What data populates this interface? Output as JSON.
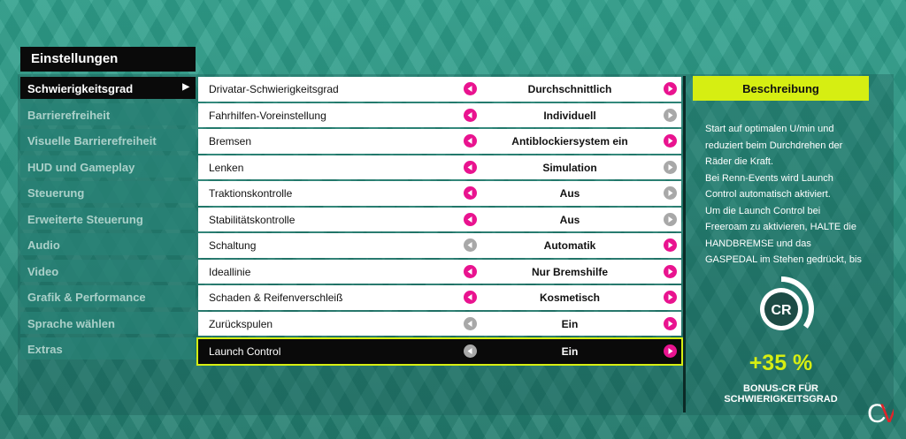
{
  "page": {
    "title": "Einstellungen"
  },
  "sidebar": {
    "items": [
      {
        "label": "Schwierigkeitsgrad",
        "active": true
      },
      {
        "label": "Barrierefreiheit"
      },
      {
        "label": "Visuelle Barrierefreiheit"
      },
      {
        "label": "HUD und Gameplay"
      },
      {
        "label": "Steuerung"
      },
      {
        "label": "Erweiterte Steuerung"
      },
      {
        "label": "Audio"
      },
      {
        "label": "Video"
      },
      {
        "label": "Grafik & Performance"
      },
      {
        "label": "Sprache wählen"
      },
      {
        "label": "Extras"
      }
    ]
  },
  "settings": [
    {
      "label": "Drivatar-Schwierigkeitsgrad",
      "value": "Durchschnittlich",
      "prev_enabled": true,
      "next_enabled": true
    },
    {
      "label": "Fahrhilfen-Voreinstellung",
      "value": "Individuell",
      "prev_enabled": true,
      "next_enabled": false
    },
    {
      "label": "Bremsen",
      "value": "Antiblockiersystem ein",
      "prev_enabled": true,
      "next_enabled": true
    },
    {
      "label": "Lenken",
      "value": "Simulation",
      "prev_enabled": true,
      "next_enabled": false
    },
    {
      "label": "Traktionskontrolle",
      "value": "Aus",
      "prev_enabled": true,
      "next_enabled": false
    },
    {
      "label": "Stabilitätskontrolle",
      "value": "Aus",
      "prev_enabled": true,
      "next_enabled": false
    },
    {
      "label": "Schaltung",
      "value": "Automatik",
      "prev_enabled": false,
      "next_enabled": true
    },
    {
      "label": "Ideallinie",
      "value": "Nur Bremshilfe",
      "prev_enabled": true,
      "next_enabled": true
    },
    {
      "label": "Schaden & Reifenverschleiß",
      "value": "Kosmetisch",
      "prev_enabled": true,
      "next_enabled": true
    },
    {
      "label": "Zurückspulen",
      "value": "Ein",
      "prev_enabled": false,
      "next_enabled": true
    },
    {
      "label": "Launch Control",
      "value": "Ein",
      "prev_enabled": false,
      "next_enabled": true,
      "focused": true
    }
  ],
  "description": {
    "heading": "Beschreibung",
    "lines": [
      "Start auf optimalen U/min und",
      "reduziert beim Durchdrehen der",
      "Räder die Kraft.",
      "Bei Renn-Events wird Launch",
      "Control automatisch aktiviert.",
      "Um die Launch Control bei",
      "Freeroam zu aktivieren, HALTE die",
      "HANDBREMSE und das",
      "GASPEDAL im Stehen gedrückt, bis"
    ]
  },
  "bonus": {
    "badge": "CR",
    "percent": "+35 %",
    "label": "BONUS-CR FÜR SCHWIERIGKEITSGRAD",
    "gauge_fraction": 0.35
  },
  "watermark": "CV",
  "colors": {
    "accent_pink": "#e9138f",
    "accent_lime": "#d6ee12",
    "disabled": "#a8a8a8"
  }
}
